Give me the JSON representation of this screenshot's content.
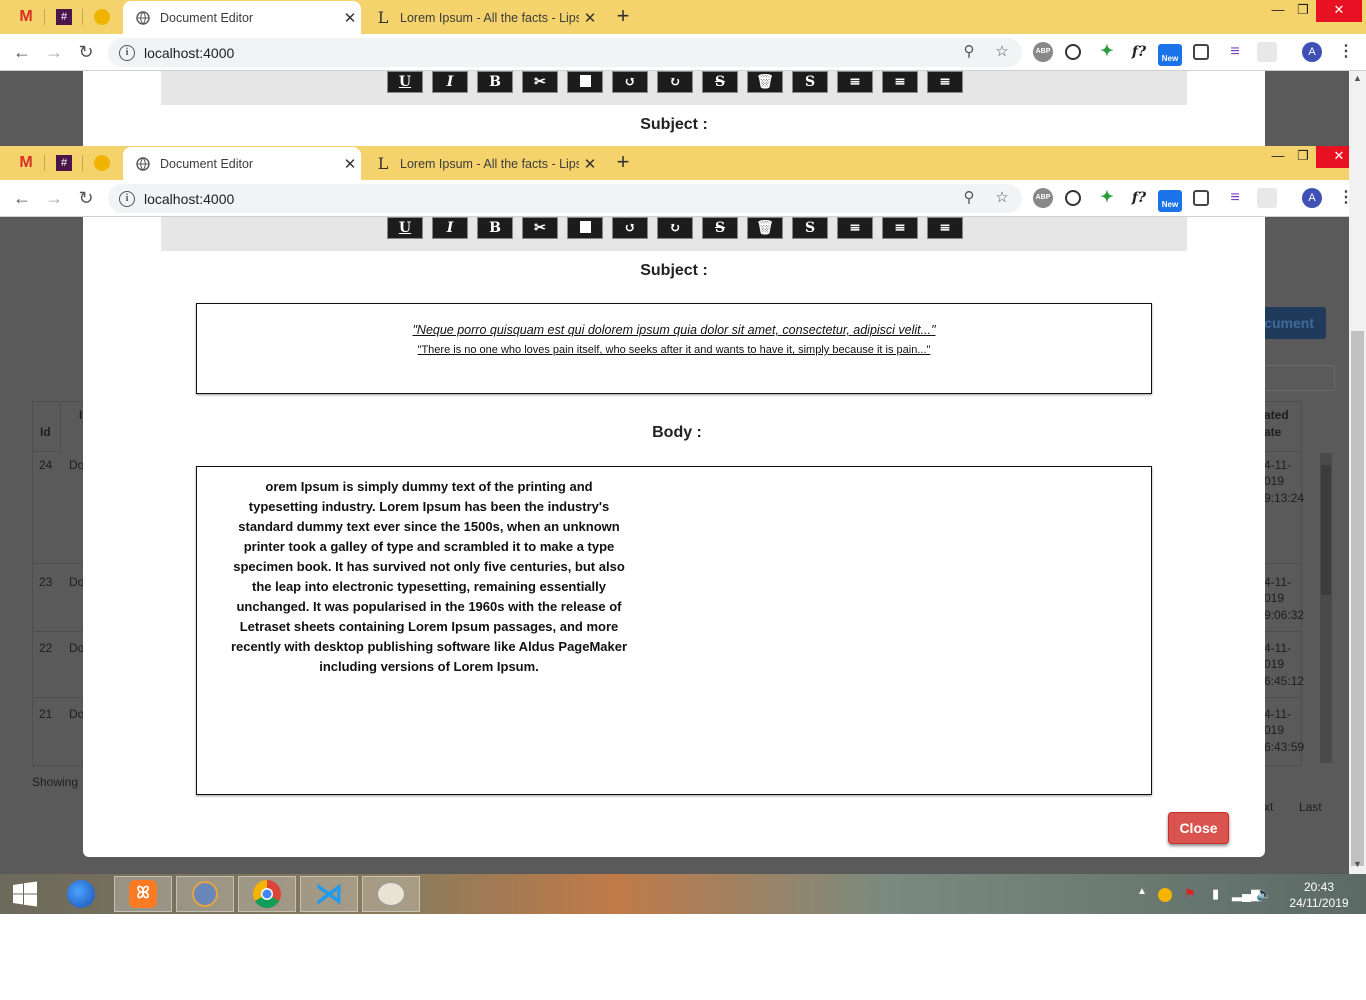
{
  "browser": {
    "tabs": [
      {
        "title": "Document Editor",
        "active": true
      },
      {
        "title": "Lorem Ipsum - All the facts - Lips",
        "active": false
      }
    ],
    "new_tab": "+",
    "url": "localhost:4000",
    "window": {
      "minimize": "—",
      "restore": "❐",
      "close": "✕"
    },
    "avatar_letter": "A",
    "ext_new_badge": "New",
    "ext_abp": "ABP",
    "ext_formula": "f?"
  },
  "editor_toolbar": {
    "buttons": [
      {
        "label": "U",
        "icon": "underline-icon"
      },
      {
        "label": "I",
        "icon": "italic-icon"
      },
      {
        "label": "B",
        "icon": "bold-icon"
      },
      {
        "label": "✂",
        "icon": "scissors-icon"
      },
      {
        "label": "",
        "icon": "image-icon"
      },
      {
        "label": "↺",
        "icon": "undo-icon"
      },
      {
        "label": "↻",
        "icon": "redo-icon"
      },
      {
        "label": "S",
        "icon": "strikethrough-icon"
      },
      {
        "label": "🗑",
        "icon": "trash-icon"
      },
      {
        "label": "S",
        "icon": "text-style-icon"
      },
      {
        "label": "≡",
        "icon": "align-center-icon"
      },
      {
        "label": "≡",
        "icon": "align-left-icon"
      },
      {
        "label": "≡",
        "icon": "align-right-icon"
      }
    ]
  },
  "modal": {
    "subject_label": "Subject :",
    "subject_quote1": "\"Neque porro quisquam est qui dolorem ipsum quia dolor sit amet, consectetur, adipisci velit...\"",
    "subject_quote2": "\"There is no one who loves pain itself, who seeks after it and wants to have it, simply because it is pain...\"",
    "body_label": "Body :",
    "body_text": "orem Ipsum is simply dummy text of the printing and typesetting industry. Lorem Ipsum has been the industry's standard dummy text ever since the 1500s, when an unknown printer took a galley of type and scrambled it to make a type specimen book. It has survived not only five centuries, but also the leap into electronic typesetting, remaining essentially unchanged. It was popularised in the 1960s with the release of Letraset sheets containing Lorem Ipsum passages, and more recently with desktop publishing software like Aldus PageMaker including versions of Lorem Ipsum.",
    "close_label": "Close"
  },
  "background_page": {
    "create_button_fragment": "cument",
    "id_header": "Id",
    "date_header_line1": "ated",
    "date_header_line2": "ate",
    "rows": [
      {
        "id": "24",
        "name": "Do",
        "date1": "4-11-",
        "date2": "019",
        "date3": "9:13:24"
      },
      {
        "id": "23",
        "name": "Do",
        "date1": "4-11-",
        "date2": "019",
        "date3": "9:06:32"
      },
      {
        "id": "22",
        "name": "Do",
        "date1": "4-11-",
        "date2": "019",
        "date3": "6:45:12"
      },
      {
        "id": "21",
        "name": "Do",
        "date1": "4-11-",
        "date2": "019",
        "date3": "6:43:59"
      }
    ],
    "showing": "Showing",
    "pager_next": "xt",
    "pager_last": "Last"
  },
  "taskbar": {
    "clock_time": "20:43",
    "clock_date": "24/11/2019"
  }
}
